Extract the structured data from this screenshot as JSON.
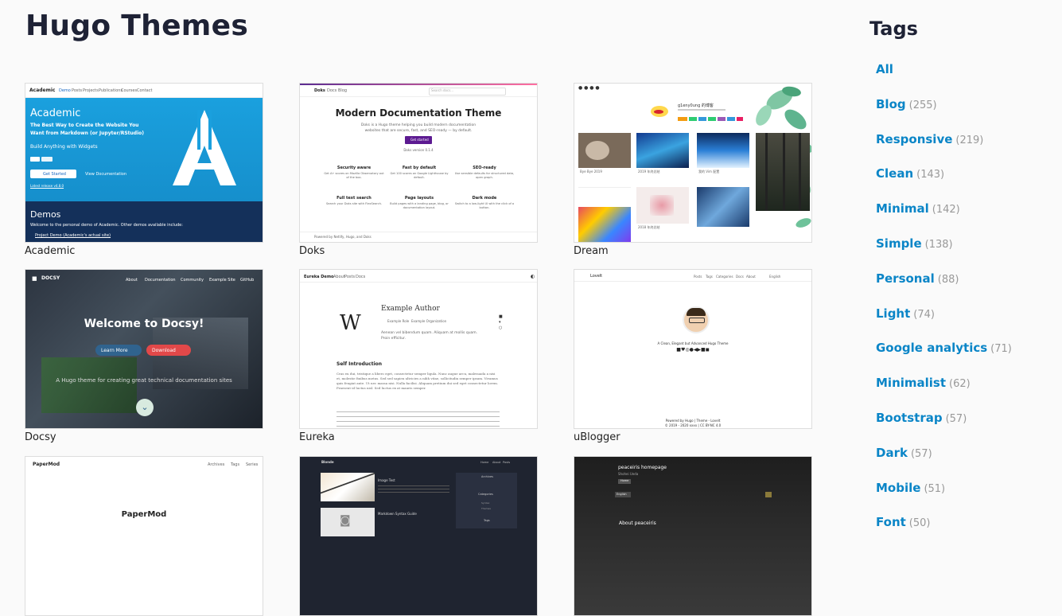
{
  "page": {
    "title": "Hugo Themes"
  },
  "tags": {
    "title": "Tags",
    "items": [
      {
        "name": "All",
        "count": ""
      },
      {
        "name": "Blog",
        "count": "(255)"
      },
      {
        "name": "Responsive",
        "count": "(219)"
      },
      {
        "name": "Clean",
        "count": "(143)"
      },
      {
        "name": "Minimal",
        "count": "(142)"
      },
      {
        "name": "Simple",
        "count": "(138)"
      },
      {
        "name": "Personal",
        "count": "(88)"
      },
      {
        "name": "Light",
        "count": "(74)"
      },
      {
        "name": "Google analytics",
        "count": "(71)"
      },
      {
        "name": "Minimalist",
        "count": "(62)"
      },
      {
        "name": "Bootstrap",
        "count": "(57)"
      },
      {
        "name": "Dark",
        "count": "(57)"
      },
      {
        "name": "Mobile",
        "count": "(51)"
      },
      {
        "name": "Font",
        "count": "(50)"
      }
    ]
  },
  "themes": [
    {
      "name": "Academic"
    },
    {
      "name": "Doks"
    },
    {
      "name": "Dream"
    },
    {
      "name": "Docsy"
    },
    {
      "name": "Eureka"
    },
    {
      "name": "uBlogger"
    },
    {
      "name": "PaperMod"
    },
    {
      "name": "Blonde"
    },
    {
      "name": "peaceiris homepage"
    }
  ],
  "thumbs": {
    "academic": {
      "brand": "Academic",
      "nav": [
        "Demo",
        "Posts",
        "Projects",
        "Publications",
        "Courses",
        "Contact"
      ],
      "hero_title": "Academic",
      "hero_sub1": "The Best Way to Create the Website You",
      "hero_sub2": "Want from Markdown (or Jupyter/RStudio)",
      "hero_sub3": "Build Anything with Widgets",
      "cta": "Get Started",
      "link": "View Documentation",
      "latest": "Latest release v4.8.0",
      "demos_title": "Demos",
      "demos_text": "Welcome to the personal demo of Academic. Other demos available include:",
      "demos_link": "Project Demo (Academic's actual site)"
    },
    "doks": {
      "brand": "Doks",
      "nav": [
        "Docs",
        "Blog"
      ],
      "search": "Search docs...",
      "title": "Modern Documentation Theme",
      "text1": "Doks is a Hugo theme helping you build modern documentation",
      "text2": "websites that are secure, fast, and SEO-ready — by default.",
      "cta": "Get started",
      "version": "Doks version 0.1.4",
      "features": [
        {
          "title": "Security aware",
          "text": "Get A+ scores on Mozilla Observatory out of the box."
        },
        {
          "title": "Fast by default",
          "text": "Get 100 scores on Google Lighthouse by default."
        },
        {
          "title": "SEO-ready",
          "text": "Use sensible defaults for structured data, open graph."
        },
        {
          "title": "Full text search",
          "text": "Search your Doks site with FlexSearch."
        },
        {
          "title": "Page layouts",
          "text": "Build pages with a landing page, blog, or documentation layout."
        },
        {
          "title": "Dark mode",
          "text": "Switch to a low-light UI with the click of a button."
        }
      ],
      "footer": "Powered by Netlify, Hugo, and Doks"
    },
    "dream": {
      "author": "g1eny0ung 的博客",
      "caption1": "2018 年终总结",
      "caption2": "Bye Bye 2019",
      "caption3": "2019 年终总结",
      "caption4": "我的 Vim 配置"
    },
    "docsy": {
      "brand": "DOCSY",
      "nav": [
        "About",
        "Documentation",
        "Community",
        "Example Site",
        "GitHub"
      ],
      "title": "Welcome to Docsy!",
      "learn": "Learn More",
      "download": "Download",
      "sub": "A Hugo theme for creating great technical documentation sites"
    },
    "eureka": {
      "brand": "Eureka Demo",
      "nav": [
        "About",
        "Posts",
        "Docs"
      ],
      "letter": "W",
      "author": "Example Author",
      "meta1": "Example Role",
      "meta2": "Example Organization",
      "bio": "Aenean vel bibendum quam. Aliquam at mollis quam. Proin efficitur.",
      "section": "Self Introduction",
      "para": "Cras eu dui, tristique a libero eget, consectetur semper ligula. Nunc augue arcu, malesuada a nisi et, molestie finibus metus. Sed sed sapien ultricies a nibh vitae, sollicitudin semper ipsum. Vivamus quis feugiat ante. Ut nec massa nisi. Nulla facilisi. Aliquam pretium dui sed eget consectetur lorem. Praesent id luctus nisl. Sed luctus ex at mauris semper."
    },
    "ublogger": {
      "brand": "Lovelt",
      "nav": [
        "Posts",
        "Tags",
        "Categories",
        "Docs",
        "About",
        "English"
      ],
      "tagline": "A Clean, Elegant but Advanced Hugo Theme",
      "footer1": "Powered by Hugo | Theme - Lovelt",
      "footer2": "© 2019 - 2020 xxxx | CC BY-NC 4.0"
    },
    "papermod": {
      "brand": "PaperMod",
      "nav": [
        "Archives",
        "Tags",
        "Series"
      ],
      "title": "PaperMod"
    },
    "blonde": {
      "brand": "Blonde",
      "nav": [
        "Home",
        "About",
        "Posts"
      ],
      "post1": "Image Test",
      "post2": "Markdown Syntax Guide",
      "side1": "Archives",
      "side2": "Categories",
      "side3": "Syntax",
      "side4": "Themes",
      "side5": "Tags"
    },
    "peaceiris": {
      "title": "peaceiris homepage",
      "sub": "Shohei Ueda",
      "btn": "Home",
      "lang": "English",
      "section": "About peaceiris"
    }
  }
}
